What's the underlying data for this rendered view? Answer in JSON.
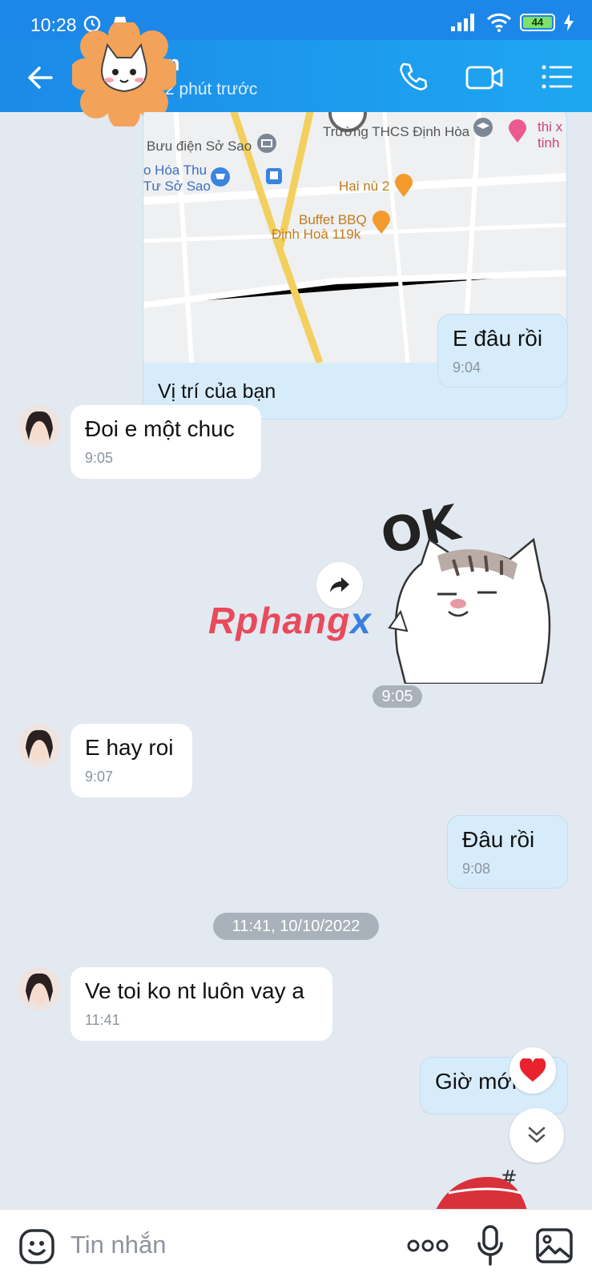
{
  "status_bar": {
    "time": "10:28",
    "battery": "44"
  },
  "header": {
    "name": "n",
    "status": "2 phút trước"
  },
  "map_card": {
    "caption": "Vị trí của bạn",
    "labels": {
      "school": "Trường THCS Định Hòa",
      "post_office": "Bưu điện Sở Sao",
      "shop_1": "o Hóa Thu",
      "shop_2": "Tư Sở Sao",
      "restaurant": "Hai nù 2",
      "bbq_1": "Buffet BBQ",
      "bbq_2": "Định Hoà 119k",
      "corner_1": "thi x",
      "corner_2": "tinh"
    }
  },
  "messages": [
    {
      "side": "me",
      "text": "E đâu rồi",
      "time": "9:04"
    },
    {
      "side": "them",
      "text": "Đoi e một chuc",
      "time": "9:05"
    },
    {
      "side": "me",
      "sticker": "ok-cat",
      "time": "9:05"
    },
    {
      "side": "them",
      "text": "E hay roi",
      "time": "9:07"
    },
    {
      "side": "me",
      "text": "Đâu rồi",
      "time": "9:08"
    },
    {
      "side": "them",
      "text": "Ve toi ko nt luôn vay a",
      "time": "11:41"
    },
    {
      "side": "me",
      "text": "Giờ mới tới"
    }
  ],
  "date_separator": "11:41, 10/10/2022",
  "watermark": {
    "part1": "Rphang",
    "part2": "x"
  },
  "input": {
    "placeholder": "Tin nhắn"
  },
  "colors": {
    "header_blue": "#1b8ae8",
    "my_bubble": "#d7ecfb",
    "chat_bg": "#e2e9f1"
  }
}
